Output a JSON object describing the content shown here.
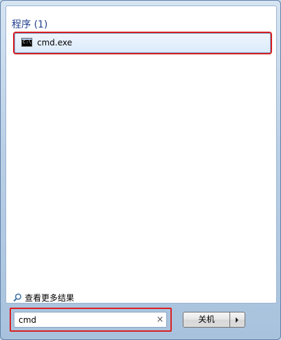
{
  "results": {
    "section_header": "程序 (1)",
    "items": [
      {
        "label": "cmd.exe",
        "icon": "cmd-icon"
      }
    ],
    "see_more_label": "查看更多结果",
    "see_more_icon": "search-icon"
  },
  "search": {
    "value": "cmd",
    "clear_glyph": "×",
    "clear_icon": "clear-icon"
  },
  "shutdown": {
    "label": "关机",
    "arrow_icon": "right-arrow-icon"
  },
  "colors": {
    "header_text": "#1e3e8c",
    "highlight_red": "#d81e1e",
    "selected_bg": "#dcebfc",
    "frame_blue": "#b9cfe6"
  }
}
